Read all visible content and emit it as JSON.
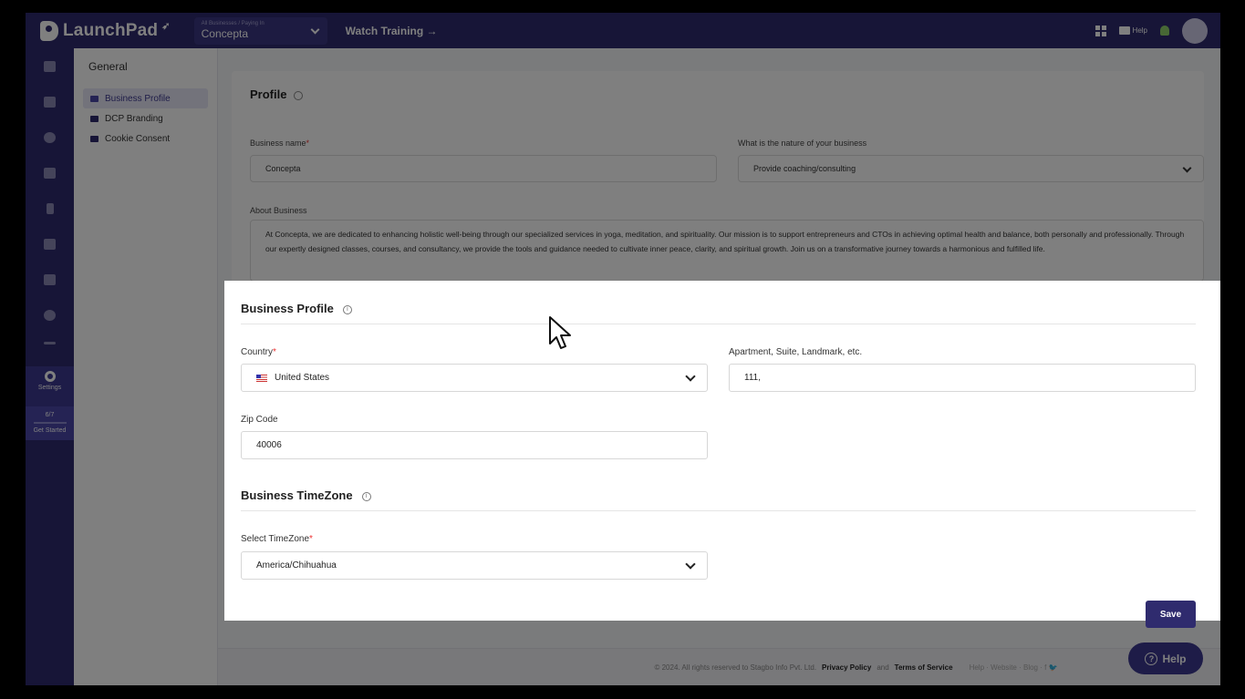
{
  "app": {
    "logo_text": "LaunchPad",
    "business_switcher": {
      "caption": "All Businesses / Paying In",
      "name": "Concepta"
    },
    "watch_training": "Watch Training →",
    "help_label": "Help"
  },
  "rail": {
    "settings_label": "Settings",
    "progress": "6/7",
    "get_started": "Get Started"
  },
  "submenu": {
    "title": "General",
    "items": [
      {
        "label": "Business Profile"
      },
      {
        "label": "DCP Branding"
      },
      {
        "label": "Cookie Consent"
      }
    ]
  },
  "profile_card": {
    "title": "Profile",
    "business_name_label": "Business name",
    "business_name_value": "Concepta",
    "nature_label": "What is the nature of your business",
    "nature_value": "Provide coaching/consulting",
    "about_label": "About Business",
    "about_value": "At Concepta, we are dedicated to enhancing holistic well-being through our specialized services in yoga, meditation, and spirituality. Our mission is to support entrepreneurs and CTOs in achieving optimal health and balance, both personally and professionally. Through our expertly designed classes, courses, and consultancy, we provide the tools and guidance needed to cultivate inner peace, clarity, and spiritual growth. Join us on a transformative journey towards a harmonious and fulfilled life."
  },
  "modal": {
    "business_profile_title": "Business Profile",
    "country_label": "Country",
    "country_value": "United States",
    "apartment_label": "Apartment, Suite, Landmark, etc.",
    "apartment_value": "111,",
    "zip_label": "Zip Code",
    "zip_value": "40006",
    "timezone_title": "Business TimeZone",
    "select_timezone_label": "Select TimeZone",
    "timezone_value": "America/Chihuahua",
    "save_label": "Save",
    "required_mark": "*",
    "info_glyph": "i"
  },
  "footer": {
    "copyright": "© 2024. All rights reserved to Stagbo Info Pvt. Ltd.",
    "privacy": "Privacy Policy",
    "and": "and",
    "terms": "Terms of Service",
    "links": "Help · Website · Blog · f 🐦"
  },
  "help_fab": {
    "label": "Help",
    "glyph": "?"
  },
  "colors": {
    "brand": "#2f2b6e",
    "accent": "#3d3990",
    "required": "#e33333"
  }
}
